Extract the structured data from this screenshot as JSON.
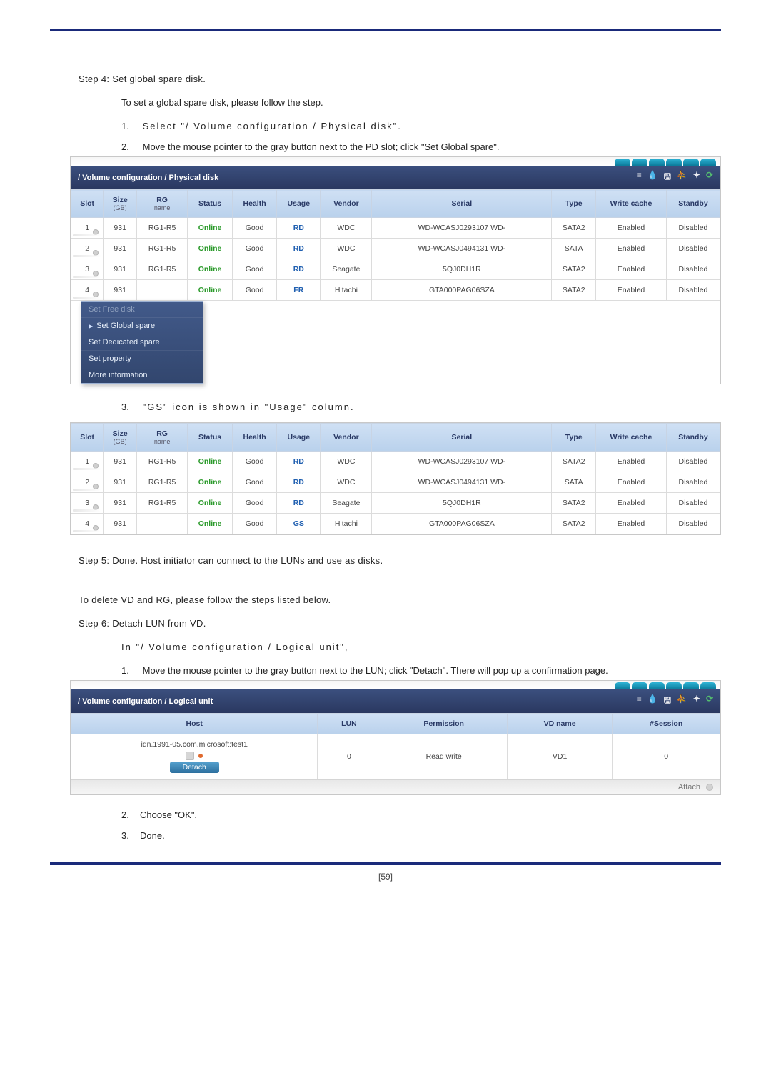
{
  "page_number": "[59]",
  "step4": {
    "title": "Step 4:  Set global spare disk.",
    "lead": "To set a global spare disk, please follow the step.",
    "items": [
      "Select \"/  Volume configuration /  Physical disk\".",
      "Move the mouse pointer to the gray button next to the PD slot; click \"Set Global spare\".",
      "\"GS\" icon is shown in \"Usage\" column."
    ]
  },
  "step5": "Step 5:  Done. Host initiator can connect to the LUNs and use as disks.",
  "delete_intro": "To delete VD and RG, please follow the steps listed below.",
  "step6": {
    "title": "Step 6: Detach LUN from VD.",
    "lead": "In \"/  Volume configuration /  Logical unit\",",
    "items": [
      "Move the mouse pointer to the gray button next to the LUN; click \"Detach\". There will pop up a confirmation page.",
      "Choose \"OK\".",
      "Done."
    ]
  },
  "phys_shot": {
    "breadcrumb": "/ Volume configuration / Physical disk",
    "headers": [
      "Slot",
      "Size",
      "RG",
      "Status",
      "Health",
      "Usage",
      "Vendor",
      "Serial",
      "Type",
      "Write cache",
      "Standby"
    ],
    "size_sub": "(GB)",
    "rg_sub": "name",
    "rows": [
      {
        "slot": "1",
        "size": "931",
        "rg": "RG1-R5",
        "status": "Online",
        "health": "Good",
        "usage": "RD",
        "vendor": "WDC",
        "serial": "WD-WCASJ0293107 WD-",
        "type": "SATA2",
        "wc": "Enabled",
        "sb": "Disabled"
      },
      {
        "slot": "2",
        "size": "931",
        "rg": "RG1-R5",
        "status": "Online",
        "health": "Good",
        "usage": "RD",
        "vendor": "WDC",
        "serial": "WD-WCASJ0494131 WD-",
        "type": "SATA",
        "wc": "Enabled",
        "sb": "Disabled"
      },
      {
        "slot": "3",
        "size": "931",
        "rg": "RG1-R5",
        "status": "Online",
        "health": "Good",
        "usage": "RD",
        "vendor": "Seagate",
        "serial": "5QJ0DH1R",
        "type": "SATA2",
        "wc": "Enabled",
        "sb": "Disabled"
      },
      {
        "slot": "4",
        "size": "931",
        "rg": "",
        "status": "Online",
        "health": "Good",
        "usage": "FR",
        "vendor": "Hitachi",
        "serial": "GTA000PAG06SZA",
        "type": "SATA2",
        "wc": "Enabled",
        "sb": "Disabled"
      }
    ],
    "menu": [
      "Set Free disk",
      "Set Global spare",
      "Set Dedicated spare",
      "Set property",
      "More information"
    ],
    "menu_active_index": 1,
    "menu_muted_index": 0
  },
  "phys_shot2": {
    "headers": [
      "Slot",
      "Size",
      "RG",
      "Status",
      "Health",
      "Usage",
      "Vendor",
      "Serial",
      "Type",
      "Write cache",
      "Standby"
    ],
    "size_sub": "(GB)",
    "rg_sub": "name",
    "rows": [
      {
        "slot": "1",
        "size": "931",
        "rg": "RG1-R5",
        "status": "Online",
        "health": "Good",
        "usage": "RD",
        "vendor": "WDC",
        "serial": "WD-WCASJ0293107 WD-",
        "type": "SATA2",
        "wc": "Enabled",
        "sb": "Disabled"
      },
      {
        "slot": "2",
        "size": "931",
        "rg": "RG1-R5",
        "status": "Online",
        "health": "Good",
        "usage": "RD",
        "vendor": "WDC",
        "serial": "WD-WCASJ0494131 WD-",
        "type": "SATA",
        "wc": "Enabled",
        "sb": "Disabled"
      },
      {
        "slot": "3",
        "size": "931",
        "rg": "RG1-R5",
        "status": "Online",
        "health": "Good",
        "usage": "RD",
        "vendor": "Seagate",
        "serial": "5QJ0DH1R",
        "type": "SATA2",
        "wc": "Enabled",
        "sb": "Disabled"
      },
      {
        "slot": "4",
        "size": "931",
        "rg": "",
        "status": "Online",
        "health": "Good",
        "usage": "GS",
        "vendor": "Hitachi",
        "serial": "GTA000PAG06SZA",
        "type": "SATA2",
        "wc": "Enabled",
        "sb": "Disabled"
      }
    ]
  },
  "lun_shot": {
    "breadcrumb": "/ Volume configuration / Logical unit",
    "headers": [
      "Host",
      "LUN",
      "Permission",
      "VD name",
      "#Session"
    ],
    "row": {
      "host": "iqn.1991-05.com.microsoft:test1",
      "lun": "0",
      "perm": "Read write",
      "vd": "VD1",
      "sess": "0"
    },
    "detach_label": "Detach",
    "attach_label": "Attach"
  }
}
